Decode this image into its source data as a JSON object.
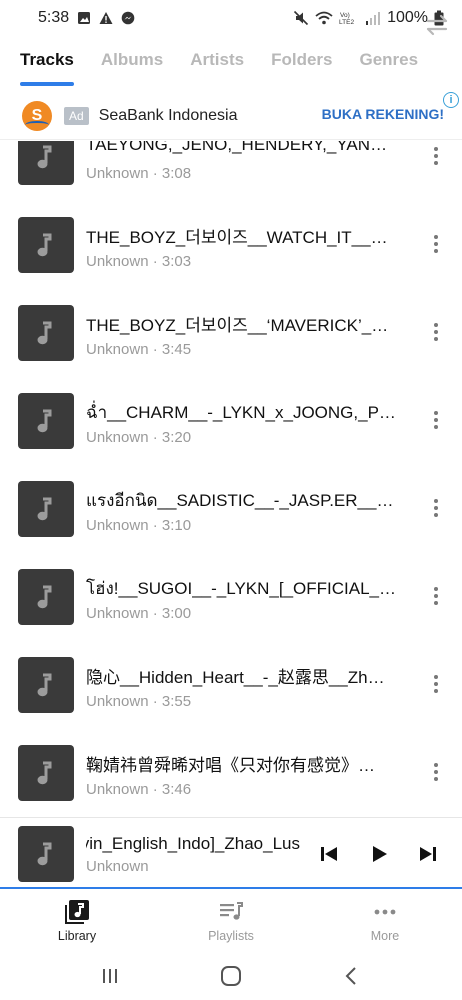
{
  "status_bar": {
    "time": "5:38",
    "battery": "100%",
    "network": "Vo) LTE2"
  },
  "tabs": [
    {
      "label": "Tracks",
      "active": true
    },
    {
      "label": "Albums",
      "active": false
    },
    {
      "label": "Artists",
      "active": false
    },
    {
      "label": "Folders",
      "active": false
    },
    {
      "label": "Genres",
      "active": false
    }
  ],
  "ad": {
    "logo_letter": "S",
    "badge": "Ad",
    "name": "SeaBank Indonesia",
    "cta": "BUKA REKENING!",
    "info": "i"
  },
  "tracks": [
    {
      "title": "TAEYONG,_JENO,_HENDERY,_YANG…",
      "meta": "Unknown · 3:08"
    },
    {
      "title": "THE_BOYZ_더보이즈__WATCH_IT__…",
      "meta": "Unknown · 3:03"
    },
    {
      "title": "THE_BOYZ_더보이즈__‘MAVERICK’_…",
      "meta": "Unknown · 3:45"
    },
    {
      "title": "ฉ่ำ__CHARM__-_LYKN_x_JOONG,_P…",
      "meta": "Unknown · 3:20"
    },
    {
      "title": "แรงอีกนิด__SADISTIC__-_JASP.ER__[…",
      "meta": "Unknown · 3:10"
    },
    {
      "title": "โฮ่ง!__SUGOI__-_LYKN_[_OFFICIAL_…",
      "meta": "Unknown · 3:00"
    },
    {
      "title": "隐心__Hidden_Heart__-_赵露思__Zh…",
      "meta": "Unknown · 3:55"
    },
    {
      "title": "鞠婧祎曾舜晞对唱《只对你有感觉》…",
      "meta": "Unknown · 3:46"
    }
  ],
  "player": {
    "title": "yin_English_Indo]_Zhao_Lus",
    "artist": "Unknown"
  },
  "bottom_nav": [
    {
      "label": "Library",
      "active": true
    },
    {
      "label": "Playlists",
      "active": false
    },
    {
      "label": "More",
      "active": false
    }
  ],
  "colors": {
    "accent": "#2e7de8",
    "art_bg": "#3a3a3a",
    "ad_cta": "#2d6fc5"
  }
}
